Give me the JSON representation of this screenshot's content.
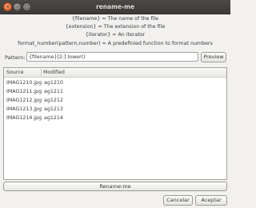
{
  "window": {
    "title": "rename-me"
  },
  "help": {
    "lines": [
      "{filename} = The name of the file",
      "{extension} = The extension of the file",
      "{iterator} = An iterator",
      "format_number(pattern,number) = A predefinied function to format numbers"
    ]
  },
  "pattern": {
    "label": "Pattern:",
    "value": "{filename}[2:].lower()"
  },
  "buttons": {
    "preview": "Preview",
    "rename": "Rename-me",
    "cancel": "Cancelar",
    "accept": "Aceptar"
  },
  "list": {
    "columns": [
      "Source",
      "Modified"
    ],
    "rows": [
      {
        "source": "IMAG1210.jpg",
        "modified": "ag1210"
      },
      {
        "source": "IMAG1211.jpg",
        "modified": "ag1211"
      },
      {
        "source": "IMAG1212.jpg",
        "modified": "ag1212"
      },
      {
        "source": "IMAG1213.jpg",
        "modified": "ag1213"
      },
      {
        "source": "IMAG1214.jpg",
        "modified": "ag1214"
      }
    ]
  }
}
